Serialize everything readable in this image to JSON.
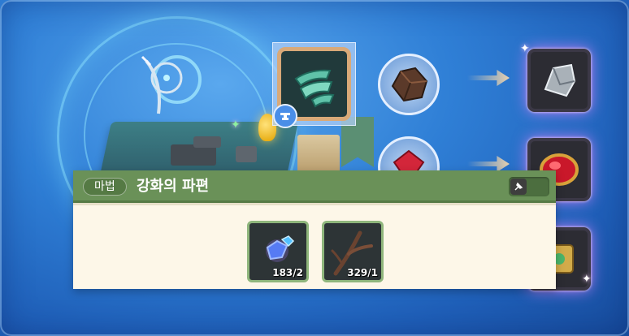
{
  "scene": {
    "background_color": "#2f7fd6",
    "selected_icon": "jade-fragment-icon",
    "selected_badge_icon": "anvil-badge-icon",
    "source_materials": [
      "dark-ore-icon",
      "red-gem-icon"
    ],
    "results": [
      "silver-ingot-icon",
      "ruby-icon",
      "gold-cube-icon"
    ]
  },
  "panel": {
    "category_tag": "마법",
    "title": "강화의 파편",
    "header_color": "#6a9158",
    "pin_icon": "pin-icon"
  },
  "materials": [
    {
      "icon": "blue-crystal-icon",
      "count": "183/2"
    },
    {
      "icon": "branch-icon",
      "count": "329/1"
    }
  ]
}
